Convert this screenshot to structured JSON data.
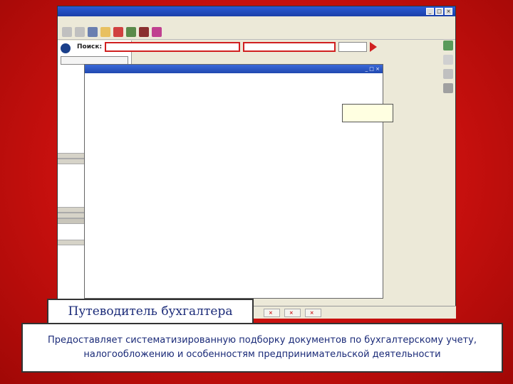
{
  "window": {
    "title": "",
    "menu": [],
    "buttons": {
      "min": "_",
      "max": "□",
      "close": "×"
    }
  },
  "left": {
    "logo": "",
    "dropdown": "",
    "sections": [
      {
        "label": ""
      },
      {
        "label": ""
      },
      {
        "label": ""
      },
      {
        "label": ""
      },
      {
        "label": ""
      },
      {
        "label": ""
      }
    ]
  },
  "search": {
    "label": "Поиск:",
    "options_left": "",
    "options_right": ""
  },
  "docwindow": {
    "title": ""
  },
  "tree": [],
  "tooltip": "",
  "taskbar": [
    {
      "label": ""
    },
    {
      "label": ""
    },
    {
      "label": ""
    }
  ],
  "caption": "Путеводитель бухгалтера",
  "description": "Предоставляет систематизированную подборку документов по бухгалтерскому учету, налогообложению и особенностям предпринимательской деятельности",
  "colors": {
    "accent": "#d02020",
    "brand": "#1a3fa8",
    "caption_text": "#1a2a78"
  }
}
